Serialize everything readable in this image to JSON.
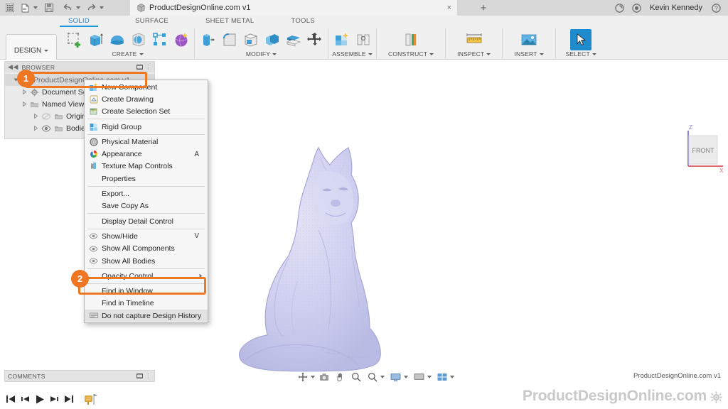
{
  "app": {
    "document_title": "ProductDesignOnline.com v1",
    "username": "Kevin Kennedy",
    "close_tab": "×",
    "new_tab": "+",
    "appbar_icons": [
      "grid-apps-icon",
      "new-file-icon",
      "save-icon",
      "undo-icon",
      "redo-icon"
    ],
    "right_icons": [
      "job-status-icon",
      "extensions-icon",
      "help-icon"
    ]
  },
  "ribbon": {
    "design_label": "DESIGN",
    "tabs": [
      {
        "label": "SOLID",
        "active": true
      },
      {
        "label": "SURFACE",
        "active": false
      },
      {
        "label": "SHEET METAL",
        "active": false
      },
      {
        "label": "TOOLS",
        "active": false
      }
    ],
    "panels": [
      {
        "label": "CREATE",
        "has_caret": true,
        "commands": [
          "create-sketch-icon",
          "extrude-icon",
          "revolve-icon",
          "sphere-icon",
          "pattern-icon",
          "mesh-icon"
        ]
      },
      {
        "label": "MODIFY",
        "has_caret": true,
        "commands": [
          "press-pull-icon",
          "fillet-icon",
          "shell-icon",
          "combine-icon",
          "offset-face-icon",
          "move-copy-icon"
        ]
      },
      {
        "label": "ASSEMBLE",
        "has_caret": true,
        "commands": [
          "new-component-icon",
          "joint-icon"
        ]
      },
      {
        "label": "CONSTRUCT",
        "has_caret": true,
        "commands": [
          "offset-plane-icon"
        ]
      },
      {
        "label": "INSPECT",
        "has_caret": true,
        "commands": [
          "measure-icon"
        ]
      },
      {
        "label": "INSERT",
        "has_caret": true,
        "commands": [
          "insert-image-icon"
        ]
      },
      {
        "label": "SELECT",
        "has_caret": true,
        "commands": [
          "select-cursor-icon"
        ],
        "selected": true
      }
    ]
  },
  "browser": {
    "title": "BROWSER",
    "tree": [
      {
        "label": "ProductDesignOnline.com v1",
        "level": 0,
        "icon": "document-icon",
        "has_arrow": true,
        "eye": false
      },
      {
        "label": "Document Settings",
        "level": 1,
        "icon": "settings-gear-icon",
        "has_arrow": true,
        "eye": false
      },
      {
        "label": "Named Views",
        "level": 1,
        "icon": "folder-icon",
        "has_arrow": true,
        "eye": false
      },
      {
        "label": "Origin",
        "level": 2,
        "icon": "folder-icon",
        "has_arrow": true,
        "eye": true,
        "eye_off": true
      },
      {
        "label": "Bodies",
        "level": 2,
        "icon": "folder-icon",
        "has_arrow": true,
        "eye": true,
        "eye_off": false
      }
    ]
  },
  "context_menu": {
    "items": [
      {
        "label": "New Component",
        "icon": "new-component-icon",
        "shortcut": "",
        "separator_after": false
      },
      {
        "label": "Create Drawing",
        "icon": "create-drawing-icon",
        "shortcut": "",
        "separator_after": false
      },
      {
        "label": "Create Selection Set",
        "icon": "create-selection-set-icon",
        "shortcut": "",
        "separator_after": true
      },
      {
        "label": "Rigid Group",
        "icon": "rigid-group-icon",
        "shortcut": "",
        "separator_after": true
      },
      {
        "label": "Physical Material",
        "icon": "physical-material-icon",
        "shortcut": "",
        "separator_after": false
      },
      {
        "label": "Appearance",
        "icon": "appearance-icon",
        "shortcut": "A",
        "separator_after": false
      },
      {
        "label": "Texture Map Controls",
        "icon": "texture-map-icon",
        "shortcut": "",
        "separator_after": false
      },
      {
        "label": "Properties",
        "icon": "",
        "shortcut": "",
        "separator_after": true
      },
      {
        "label": "Export...",
        "icon": "",
        "shortcut": "",
        "separator_after": false
      },
      {
        "label": "Save Copy As",
        "icon": "",
        "shortcut": "",
        "separator_after": true
      },
      {
        "label": "Display Detail Control",
        "icon": "",
        "shortcut": "",
        "separator_after": true
      },
      {
        "label": "Show/Hide",
        "icon": "eye-icon",
        "shortcut": "V",
        "separator_after": false
      },
      {
        "label": "Show All Components",
        "icon": "eye-icon",
        "shortcut": "",
        "separator_after": false
      },
      {
        "label": "Show All Bodies",
        "icon": "eye-icon",
        "shortcut": "",
        "separator_after": true
      },
      {
        "label": "Opacity Control",
        "icon": "",
        "shortcut": "",
        "submenu": true,
        "separator_after": true
      },
      {
        "label": "Find in Window",
        "icon": "",
        "shortcut": "",
        "separator_after": false
      },
      {
        "label": "Find in Timeline",
        "icon": "",
        "shortcut": "",
        "separator_after": false
      },
      {
        "label": "Do not capture Design History",
        "icon": "capture-history-icon",
        "shortcut": "",
        "highlighted": true,
        "separator_after": false
      }
    ]
  },
  "callouts": [
    {
      "number": "1",
      "target": "browser-root-node"
    },
    {
      "number": "2",
      "target": "do-not-capture-design-history-menu-item"
    }
  ],
  "viewcube": {
    "face_label": "FRONT",
    "z_axis_label": "Z",
    "x_axis_label": "X",
    "z_axis_color": "#8b7fd4",
    "x_axis_color": "#e06a72"
  },
  "model": {
    "name": "fox-statue-mesh",
    "fill_color": "#cfd0ef",
    "edge_color": "#a8a9d8"
  },
  "footer": {
    "comments_label": "COMMENTS",
    "credit": "ProductDesignOnline.com v1",
    "nav_icons": [
      "orbit-icon",
      "pan-icon",
      "look-at-icon",
      "zoom-icon",
      "zoom-window-icon",
      "display-settings-icon",
      "grid-snap-icon",
      "viewports-icon"
    ],
    "timeline_controls": [
      "go-to-beginning-icon",
      "step-back-icon",
      "play-playback-icon",
      "step-forward-icon",
      "go-to-end-icon",
      "timeline-marker-icon"
    ],
    "watermark": "ProductDesignOnline.com",
    "settings_icon": "gear-icon"
  },
  "colors": {
    "accent_orange": "#ef7622",
    "tab_blue": "#1a7fc1",
    "select_blue": "#1e8bcd"
  }
}
